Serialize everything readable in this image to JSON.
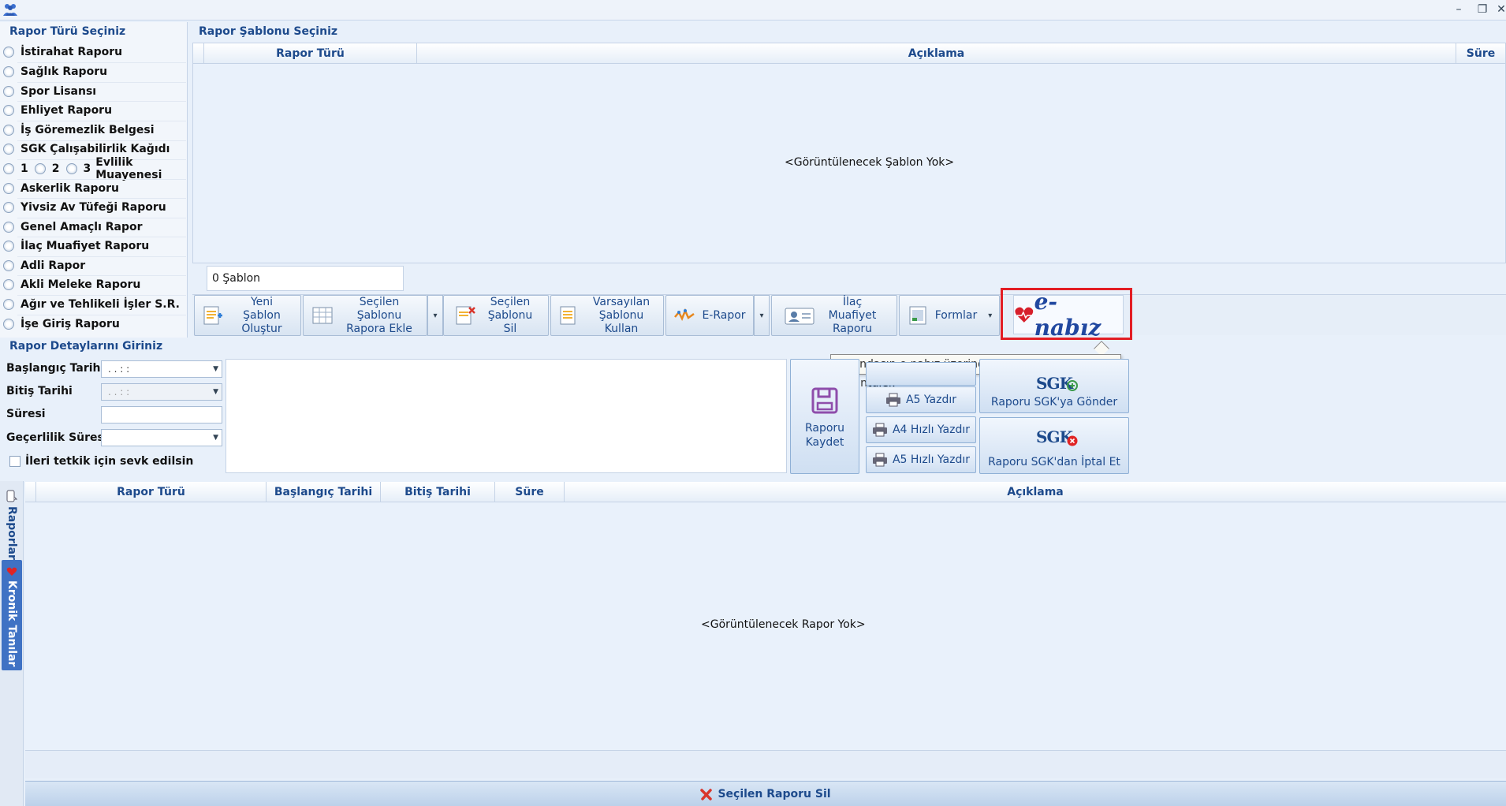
{
  "window": {
    "minimize": "–",
    "restore": "❐",
    "close": "✕"
  },
  "report_types": {
    "title": "Rapor Türü Seçiniz",
    "items": [
      "İstirahat Raporu",
      "Sağlık Raporu",
      "Spor Lisansı",
      "Ehliyet Raporu",
      "İş Göremezlik Belgesi",
      "SGK Çalışabilirlik Kağıdı",
      "",
      "Askerlik Raporu",
      "Yivsiz Av Tüfeği Raporu",
      "Genel Amaçlı Rapor",
      "İlaç Muafiyet Raporu",
      "Adli Rapor",
      "Akli Meleke Raporu",
      "Ağır ve Tehlikeli İşler S.R.",
      "İşe Giriş Raporu"
    ],
    "marriage": {
      "opt1": "1",
      "opt2": "2",
      "opt3": "3",
      "label": "Evlilik Muayenesi"
    }
  },
  "templates": {
    "title": "Rapor Şablonu Seçiniz",
    "columns": [
      "Rapor Türü",
      "Açıklama",
      "Süre"
    ],
    "empty": "<Görüntülenecek Şablon Yok>",
    "count": "0 Şablon"
  },
  "toolbar": {
    "new_template": "Yeni Şablon Oluştur",
    "add_template": "Seçilen Şablonu Rapora Ekle",
    "delete_template": "Seçilen Şablonu Sil",
    "use_default": "Varsayılan Şablonu Kullan",
    "erapor": "E-Rapor",
    "drug_exemption": "İlaç Muafiyet Raporu",
    "forms": "Formlar",
    "enabiz": "e-nabız",
    "split_arrow": "▾"
  },
  "tooltip": "Vatandaşın e-nabız üzerinden muayenelerini görüntüler.",
  "details": {
    "title": "Rapor Detaylarını Giriniz",
    "start_label": "Başlangıç Tarihi",
    "start_value": ".  .      :  :",
    "end_label": "Bitiş Tarihi",
    "end_value": ".  .      :  :",
    "duration_label": "Süresi",
    "validity_label": "Geçerlilik Süresi",
    "referral_label": "İleri tetkik için sevk edilsin",
    "dropdown_arrow": "▼"
  },
  "actions": {
    "save": "Raporu Kaydet",
    "a5_print": "A5 Yazdır",
    "a4_quick": "A4 Hızlı Yazdır",
    "a5_quick": "A5 Hızlı Yazdır",
    "send_sgk": "Raporu SGK'ya Gönder",
    "cancel_sgk": "Raporu SGK'dan İptal Et",
    "sgk_logo": "SGK"
  },
  "side_tabs": {
    "reports": "Raporlar",
    "chronic": "Kronik Tanılar"
  },
  "reports": {
    "columns": [
      "Rapor Türü",
      "Başlangıç Tarihi",
      "Bitiş Tarihi",
      "Süre",
      "Açıklama"
    ],
    "empty": "<Görüntülenecek Rapor Yok>",
    "delete": "Seçilen Raporu Sil"
  },
  "colors": {
    "accent": "#1d4a8c",
    "highlight": "#e21d24",
    "background": "#e8f0fa"
  }
}
